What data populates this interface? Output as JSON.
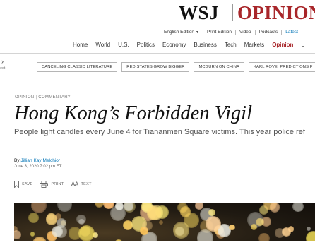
{
  "masthead": {
    "logo_left": "WSJ",
    "logo_right": "OPINION",
    "accent_color": "#a8262a"
  },
  "edition_bar": {
    "edition": "English Edition",
    "print": "Print Edition",
    "video": "Video",
    "podcasts": "Podcasts",
    "latest": "Latest"
  },
  "nav": [
    "Home",
    "World",
    "U.S.",
    "Politics",
    "Economy",
    "Business",
    "Tech",
    "Markets",
    "Opinion",
    "L"
  ],
  "nav_active": "Opinion",
  "side": {
    "arrow": "›",
    "text": "est"
  },
  "topics": [
    "CANCELING CLASSIC LITERATURE",
    "RED STATES GROW BIGGER",
    "MCGURN ON CHINA",
    "KARL ROVE: PREDICTIONS F"
  ],
  "article": {
    "kicker_section": "OPINION",
    "kicker_type": "COMMENTARY",
    "headline": "Hong Kong’s Forbidden Vigil",
    "dek": "People light candles every June 4 for Tiananmen Square victims. This year police ref",
    "byline_prefix": "By",
    "author": "Jillian Kay Melchior",
    "date": "June 3, 2020 7:02 pm ET"
  },
  "tools": {
    "save": "SAVE",
    "print": "PRINT",
    "text": "TEXT",
    "text_icon_glyph": "AA"
  },
  "photo": {
    "icon": "candle-bokeh-image"
  }
}
